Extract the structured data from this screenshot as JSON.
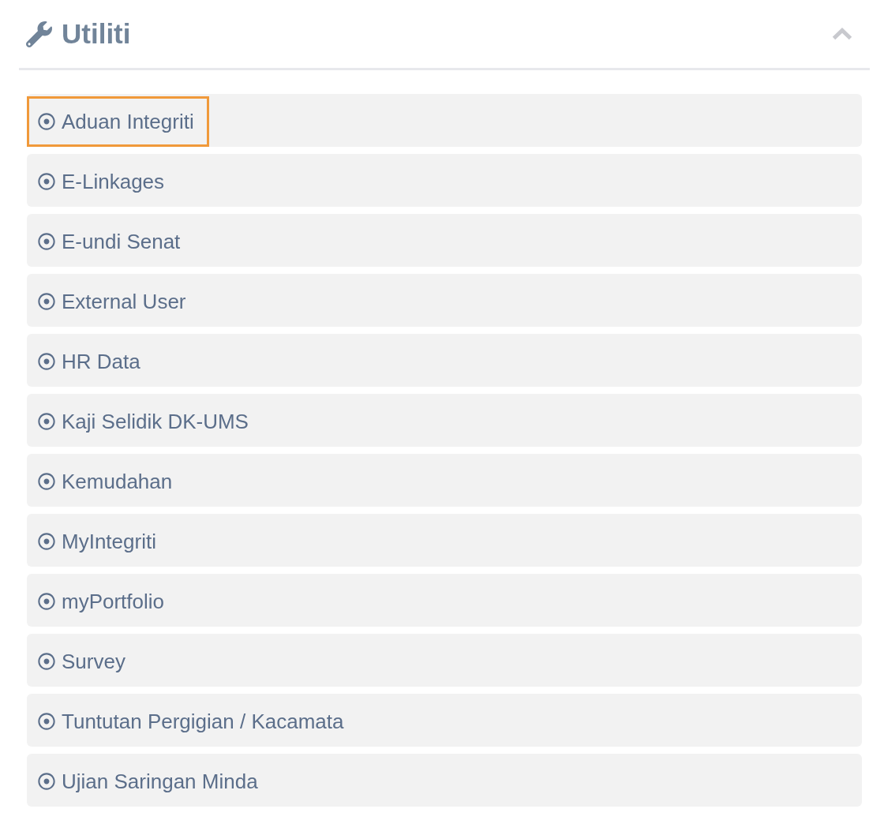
{
  "panel": {
    "title": "Utiliti",
    "expanded": true
  },
  "items": [
    {
      "label": "Aduan Integriti",
      "focused": true
    },
    {
      "label": "E-Linkages",
      "focused": false
    },
    {
      "label": "E-undi Senat",
      "focused": false
    },
    {
      "label": "External User",
      "focused": false
    },
    {
      "label": "HR Data",
      "focused": false
    },
    {
      "label": "Kaji Selidik DK-UMS",
      "focused": false
    },
    {
      "label": "Kemudahan",
      "focused": false
    },
    {
      "label": "MyIntegriti",
      "focused": false
    },
    {
      "label": "myPortfolio",
      "focused": false
    },
    {
      "label": "Survey",
      "focused": false
    },
    {
      "label": "Tuntutan Pergigian / Kacamata",
      "focused": false
    },
    {
      "label": "Ujian Saringan Minda",
      "focused": false
    }
  ]
}
